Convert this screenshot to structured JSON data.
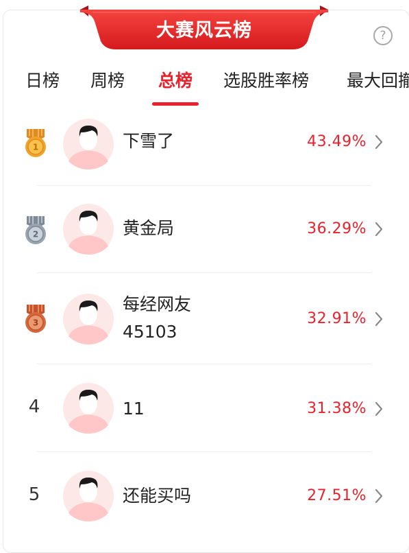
{
  "header": {
    "title": "大赛风云榜",
    "help_glyph": "?",
    "accent_color": "#e8222c"
  },
  "tabs": [
    {
      "label": "日榜"
    },
    {
      "label": "周榜"
    },
    {
      "label": "总榜",
      "active": true
    },
    {
      "label": "选股胜率榜"
    },
    {
      "label": "最大回撤"
    }
  ],
  "ranking": [
    {
      "rank": "1",
      "medal": "gold-medal-icon",
      "name_lines": [
        "下雪了"
      ],
      "return": "43.49%"
    },
    {
      "rank": "2",
      "medal": "silver-medal-icon",
      "name_lines": [
        "黄金局"
      ],
      "return": "36.29%"
    },
    {
      "rank": "3",
      "medal": "bronze-medal-icon",
      "name_lines": [
        "每经网友",
        "45103"
      ],
      "return": "32.91%"
    },
    {
      "rank": "4",
      "medal": null,
      "name_lines": [
        "11"
      ],
      "return": "31.38%"
    },
    {
      "rank": "5",
      "medal": null,
      "name_lines": [
        "还能买吗"
      ],
      "return": "27.51%"
    }
  ]
}
